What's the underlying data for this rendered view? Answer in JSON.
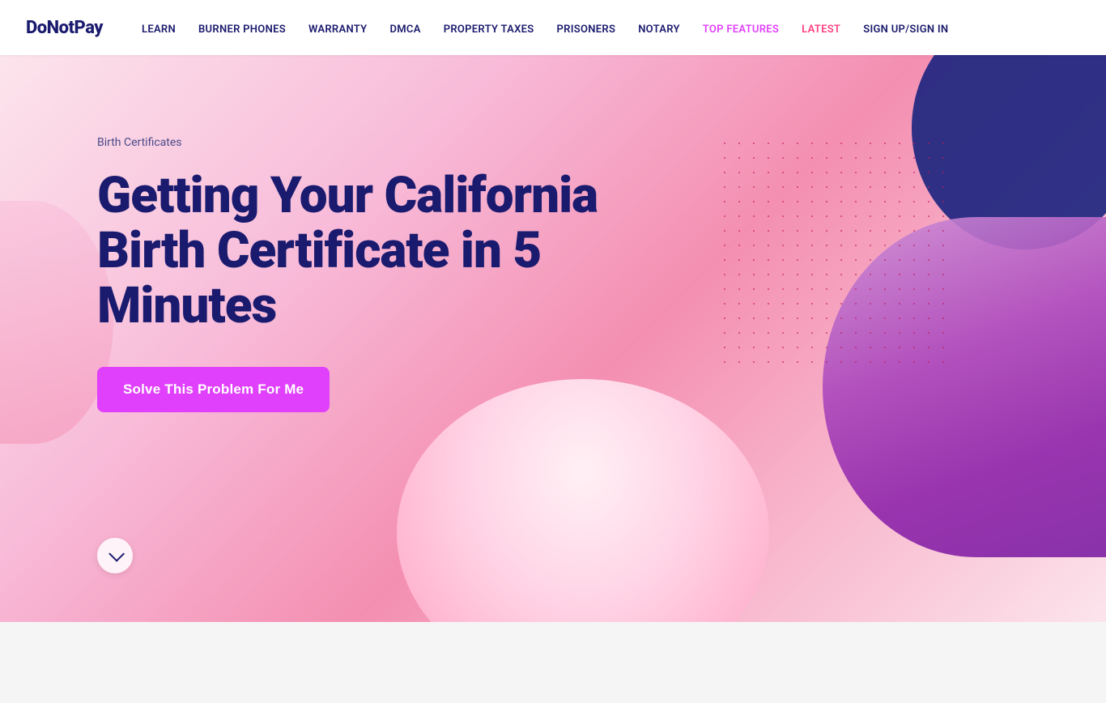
{
  "brand": {
    "logo": "DoNotPay"
  },
  "nav": {
    "links": [
      {
        "id": "learn",
        "label": "LEARN",
        "class": "normal"
      },
      {
        "id": "burner-phones",
        "label": "BURNER PHONES",
        "class": "normal"
      },
      {
        "id": "warranty",
        "label": "WARRANTY",
        "class": "normal"
      },
      {
        "id": "dmca",
        "label": "DMCA",
        "class": "normal"
      },
      {
        "id": "property-taxes",
        "label": "PROPERTY TAXES",
        "class": "normal"
      },
      {
        "id": "prisoners",
        "label": "PRISONERS",
        "class": "normal"
      },
      {
        "id": "notary",
        "label": "NOTARY",
        "class": "normal"
      },
      {
        "id": "top-features",
        "label": "TOP FEATURES",
        "class": "top-features"
      },
      {
        "id": "latest",
        "label": "LATEST",
        "class": "latest"
      },
      {
        "id": "sign-in",
        "label": "SIGN UP/SIGN IN",
        "class": "normal"
      }
    ]
  },
  "hero": {
    "breadcrumb": "Birth Certificates",
    "title": "Getting Your California Birth Certificate in 5 Minutes",
    "cta_label": "Solve This Problem For Me",
    "scroll_label": "Scroll down"
  },
  "colors": {
    "accent_purple": "#e040fb",
    "accent_pink": "#ff4081",
    "navy": "#1a1a6e",
    "bg_gradient_start": "#fce4ec",
    "bg_gradient_end": "#f8bbd9"
  }
}
